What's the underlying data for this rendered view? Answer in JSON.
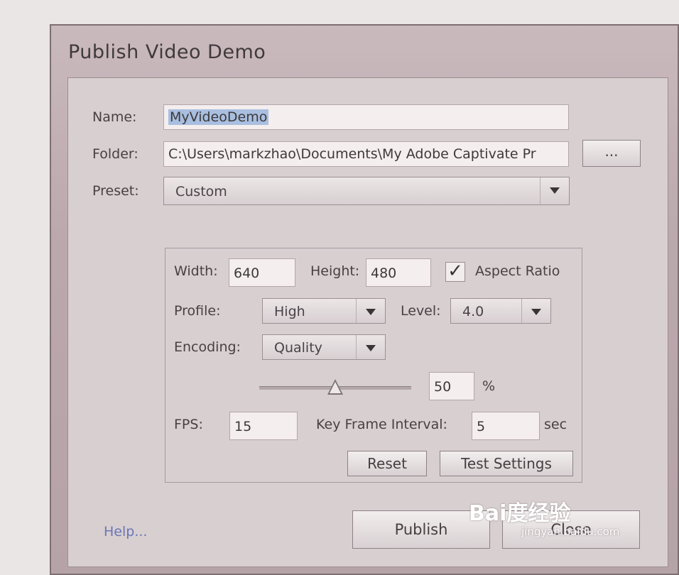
{
  "dialog": {
    "title": "Publish Video Demo",
    "name": {
      "label": "Name:",
      "value": "MyVideoDemo"
    },
    "folder": {
      "label": "Folder:",
      "value": "C:\\Users\\markzhao\\Documents\\My Adobe Captivate Pr",
      "browse_label": "..."
    },
    "preset": {
      "label": "Preset:",
      "value": "Custom"
    },
    "settings": {
      "width": {
        "label": "Width:",
        "value": "640"
      },
      "height": {
        "label": "Height:",
        "value": "480"
      },
      "aspect_ratio": {
        "label": "Aspect Ratio",
        "checked": true,
        "check_glyph": "✓"
      },
      "profile": {
        "label": "Profile:",
        "value": "High"
      },
      "level": {
        "label": "Level:",
        "value": "4.0"
      },
      "encoding": {
        "label": "Encoding:",
        "value": "Quality"
      },
      "quality": {
        "value": "50",
        "unit": "%",
        "slider_level": 0.5
      },
      "fps": {
        "label": "FPS:",
        "value": "15"
      },
      "key_frame_interval": {
        "label": "Key Frame Interval:",
        "value": "5",
        "unit": "sec"
      },
      "reset_label": "Reset",
      "test_settings_label": "Test Settings"
    },
    "help_label": "Help...",
    "publish_label": "Publish",
    "close_label": "Close"
  },
  "watermark": {
    "logo": "Bai度经验",
    "url": "jingyan.baidu.com"
  },
  "colors": {
    "dialog_bg": "#bba8ad",
    "content_bg": "#d8cfd1",
    "field_bg": "#f4eeee",
    "selection": "#a9bfe0",
    "help_link": "#6a76b5"
  },
  "icons": {
    "dropdown": "chevron-down-icon",
    "checkbox": "check-icon",
    "slider": "slider-thumb-icon"
  }
}
